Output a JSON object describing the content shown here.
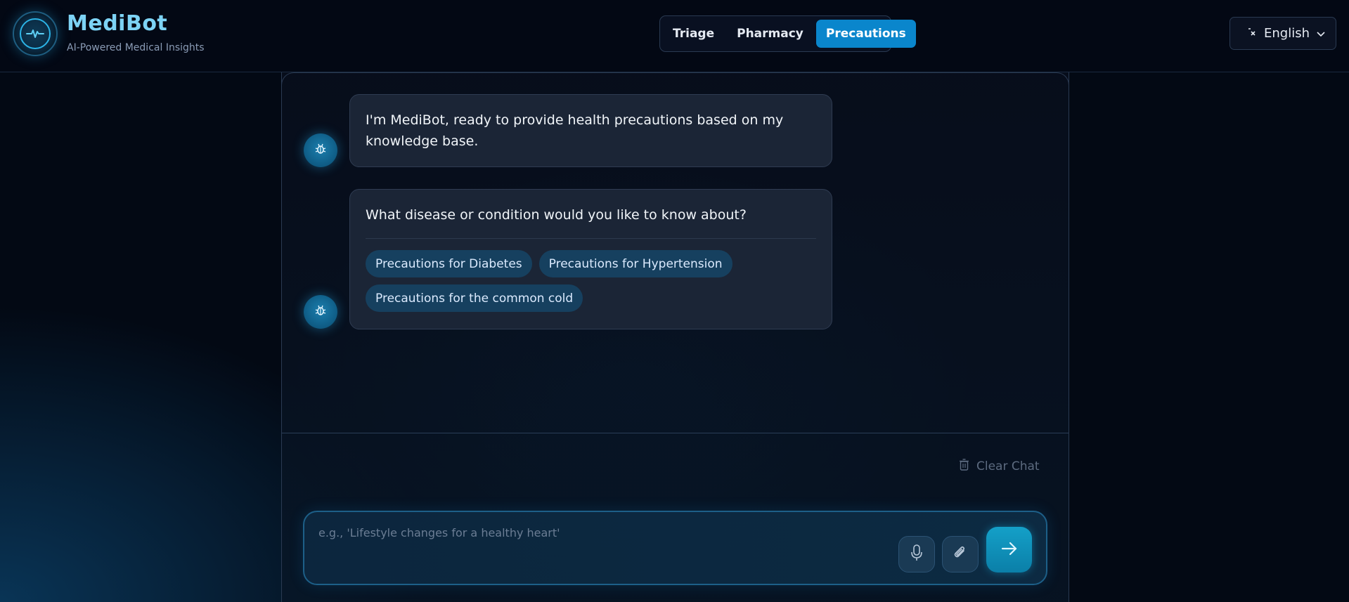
{
  "brand": {
    "title": "MediBot",
    "subtitle": "AI-Powered Medical Insights",
    "logo_icon": "heartbeat-icon"
  },
  "tabs": [
    {
      "label": "Triage",
      "active": false
    },
    {
      "label": "Pharmacy",
      "active": false
    },
    {
      "label": "Precautions",
      "active": true
    }
  ],
  "language": {
    "label": "English",
    "icon": "translate-icon"
  },
  "messages": [
    {
      "sender": "bot",
      "avatar_icon": "bug-icon",
      "text": "I'm MediBot, ready to provide health precautions based on my knowledge base."
    },
    {
      "sender": "bot",
      "avatar_icon": "bug-icon",
      "text": "What disease or condition would you like to know about?",
      "suggestions": [
        "Precautions for Diabetes",
        "Precautions for Hypertension",
        "Precautions for the common cold"
      ]
    }
  ],
  "actions": {
    "clear_chat_label": "Clear Chat"
  },
  "input": {
    "placeholder": "e.g., 'Lifestyle changes for a healthy heart'",
    "value": ""
  },
  "colors": {
    "accent": "#0a86cc",
    "brand_text": "#7dd3f5",
    "chip_bg": "#16405f",
    "background": "#030914"
  }
}
